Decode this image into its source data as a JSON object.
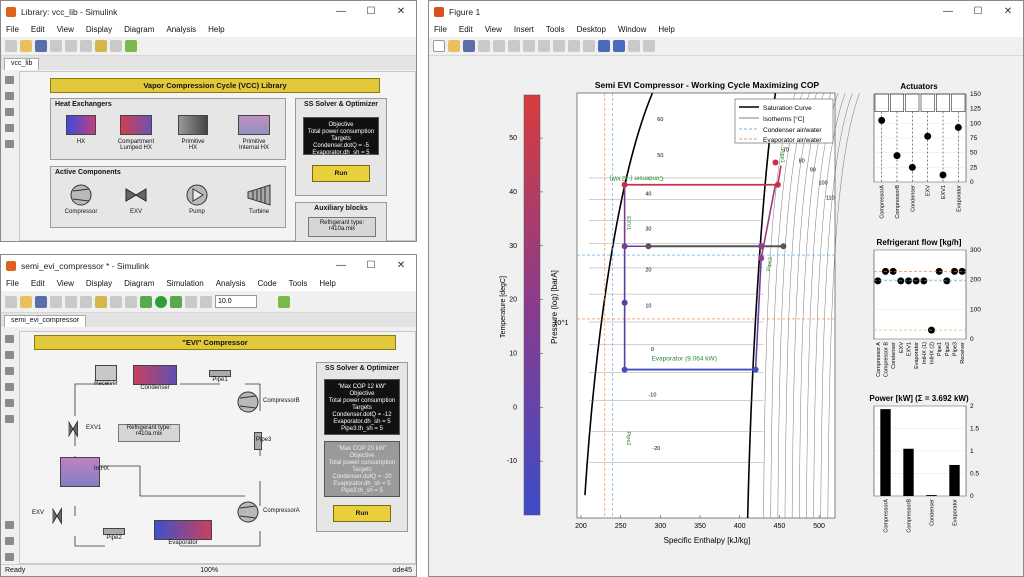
{
  "library_window": {
    "title": "Library: vcc_lib - Simulink",
    "menu": [
      "File",
      "Edit",
      "View",
      "Display",
      "Diagram",
      "Analysis",
      "Help"
    ],
    "tab": "vcc_lib",
    "header": "Vapor Compression Cycle (VCC) Library",
    "heat_exchangers": {
      "title": "Heat Exchangers",
      "items": [
        "HX",
        "Compartment\nLumped HX",
        "Primitive\nHX",
        "Primitive\nInternal HX"
      ]
    },
    "active_components": {
      "title": "Active Components",
      "items": [
        "Compressor",
        "EXV",
        "Pump",
        "Turbine"
      ]
    },
    "solver": {
      "title": "SS Solver & Optimizer",
      "box": [
        "Objective",
        "Total power consumption",
        "Targets",
        "Condenser.dotQ = -5",
        "Evaporator.dh_sh = 5"
      ],
      "run": "Run"
    },
    "aux": {
      "title": "Auxiliary blocks",
      "refrigerant": "Refrigerant type:\nr410a.mix"
    }
  },
  "model_window": {
    "title": "semi_evi_compressor * - Simulink",
    "menu": [
      "File",
      "Edit",
      "View",
      "Display",
      "Diagram",
      "Simulation",
      "Analysis",
      "Code",
      "Tools",
      "Help"
    ],
    "tab": "semi_evi_compressor",
    "sim_time": "10.0",
    "header": "\"EVI\" Compressor",
    "blocks": {
      "receiver": "Receiver",
      "condenser": "Condenser",
      "pipe1": "Pipe1",
      "compressorB": "CompressorB",
      "exv1": "EXV1",
      "intHX": "IntHX",
      "refrigerant": "Refrigerant type:\nr410a.mix",
      "pipe3": "Pipe3",
      "exv": "EXV",
      "pipe2": "Pipe2",
      "evaporator": "Evaporator",
      "compressorA": "CompressorA"
    },
    "solver": {
      "title": "SS Solver & Optimizer",
      "box1": [
        "\"Max COP 12 kW\"",
        "Objective",
        "Total power consumption",
        "Targets",
        "Condenser.dotQ = -12",
        "Evaporator.dh_sh = 5",
        "Pipe3.th_sh = 5"
      ],
      "box2": [
        "\"Max COP 20 kW\"",
        "Objective",
        "Total power consumption",
        "Targets",
        "Condenser.dotQ = -20",
        "Evaporator.dh_sh = 5",
        "Pipe3.th_sh = 5"
      ],
      "run": "Run"
    },
    "status": {
      "left": "Ready",
      "mid": "100%",
      "right": "ode45"
    }
  },
  "figure_window": {
    "title": "Figure 1",
    "menu": [
      "File",
      "Edit",
      "View",
      "Insert",
      "Tools",
      "Desktop",
      "Window",
      "Help"
    ]
  },
  "chart_data": [
    {
      "type": "line",
      "title": "Semi EVI Compressor - Working Cycle Maximizing COP",
      "xlabel": "Specific Enthalpy [kJ/kg]",
      "ylabel": "Pressure (log) [barA]",
      "xlim": [
        195,
        520
      ],
      "xticks": [
        200,
        250,
        300,
        350,
        400,
        450,
        500
      ],
      "yscale": "log",
      "ytick_label": "10^1",
      "colorbar": {
        "label": "Temperature [degC]",
        "ticks": [
          50,
          40,
          30,
          20,
          10,
          0,
          -10
        ],
        "range": [
          -20,
          58
        ]
      },
      "legend": [
        "Saturation Curve",
        "Isotherms [°C]",
        "Condenser air/water",
        "Evaporator air/water"
      ],
      "isotherm_labels": [
        "60",
        "50",
        "40",
        "30",
        "20",
        "10",
        "0",
        "-10",
        "-20",
        "70",
        "80",
        "90",
        "100",
        "110"
      ],
      "annotations": [
        "Condenser (-12 kW)",
        "Evaporator (9.064 kW)",
        "EXV1",
        "Pipe2",
        "Pipe1",
        "Pipe3"
      ],
      "series": [
        {
          "name": "Condenser (-12 kW)",
          "points": [
            [
              448,
              36
            ],
            [
              255,
              36
            ]
          ]
        },
        {
          "name": "Evaporator (9.064 kW)",
          "points": [
            [
              255,
              8.2
            ],
            [
              420,
              8.2
            ]
          ]
        },
        {
          "name": "IntHX",
          "points": [
            [
              255,
              22
            ],
            [
              427,
              22
            ]
          ]
        }
      ]
    },
    {
      "type": "scatter",
      "title": "Actuators",
      "categories": [
        "CompressorA",
        "CompressorB",
        "Condenser",
        "EXV",
        "EXV1",
        "Evaporator"
      ],
      "values": [
        105,
        45,
        25,
        78,
        12,
        93
      ],
      "ylim": [
        0,
        150
      ]
    },
    {
      "type": "scatter",
      "title": "Refrigerant flow [kg/h]",
      "categories": [
        "Compressor A",
        "Compressor B",
        "Condenser",
        "EXV",
        "EXV1",
        "Evaporator",
        "IntHX (1)",
        "IntHX (2)",
        "Pipe1",
        "Pipe2",
        "Pipe3",
        "Receiver"
      ],
      "values": [
        196,
        228,
        228,
        196,
        196,
        196,
        196,
        30,
        228,
        196,
        228,
        228
      ],
      "ylim": [
        0,
        300
      ]
    },
    {
      "type": "bar",
      "title": "Power [kW] (Σ = 3.692 kW)",
      "categories": [
        "CompressorA",
        "CompressorB",
        "Condenser",
        "Evaporator"
      ],
      "values": [
        1.93,
        1.05,
        0.02,
        0.69
      ],
      "ylim": [
        0,
        2
      ]
    }
  ]
}
